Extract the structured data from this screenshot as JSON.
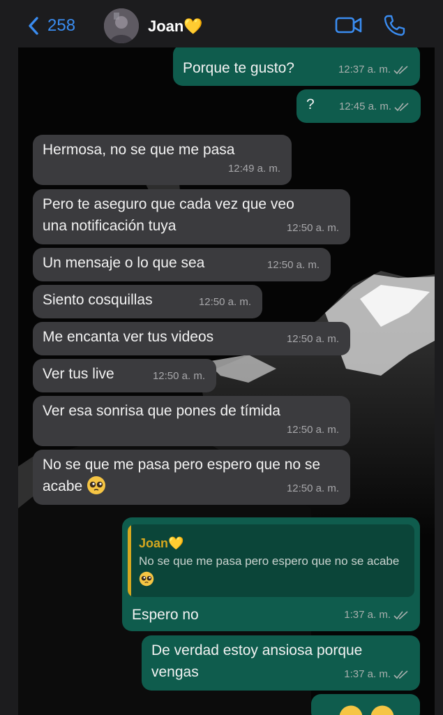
{
  "header": {
    "back_count": "258",
    "contact_name": "Joan💛",
    "icons": [
      "chevron-left-icon",
      "video-call-icon",
      "phone-icon"
    ]
  },
  "messages": [
    {
      "direction": "out",
      "text": "Porque te gusto?",
      "time": "12:37 a. m.",
      "status": "read"
    },
    {
      "direction": "out",
      "text": "?",
      "time": "12:45 a. m.",
      "status": "read"
    },
    {
      "direction": "in",
      "text": "Hermosa, no se que me pasa",
      "time": "12:49 a. m."
    },
    {
      "direction": "in",
      "text": "Pero te aseguro que cada vez que veo una notificación tuya",
      "time": "12:50 a. m."
    },
    {
      "direction": "in",
      "text": "Un mensaje o lo que sea",
      "time": "12:50 a. m."
    },
    {
      "direction": "in",
      "text": "Siento cosquillas",
      "time": "12:50 a. m."
    },
    {
      "direction": "in",
      "text": "Me encanta ver tus videos",
      "time": "12:50 a. m."
    },
    {
      "direction": "in",
      "text": "Ver tus live",
      "time": "12:50 a. m."
    },
    {
      "direction": "in",
      "text": "Ver esa sonrisa que pones de tímida",
      "time": "12:50 a. m."
    },
    {
      "direction": "in",
      "text": "No se que me pasa pero espero que no se acabe",
      "emoji": "pleading-face",
      "time": "12:50 a. m."
    },
    {
      "direction": "out",
      "quote": {
        "author": "Joan💛",
        "text": "No se que me pasa pero espero que no se acabe",
        "emoji": "pleading-face"
      },
      "text": "Espero no",
      "time": "1:37 a. m.",
      "status": "read"
    },
    {
      "direction": "out",
      "text": "De verdad estoy ansiosa porque vengas",
      "time": "1:37 a. m.",
      "status": "read"
    },
    {
      "direction": "out",
      "text": "",
      "emoji": "emoji-pair-partial",
      "status": "partial"
    }
  ],
  "colors": {
    "header_bg": "#1c1c1e",
    "accent_blue": "#3a8cf0",
    "bubble_in": "#3b3b3e",
    "bubble_out": "#0f5c4d",
    "quote_author": "#d6a81f",
    "chat_bg": "#050505"
  }
}
